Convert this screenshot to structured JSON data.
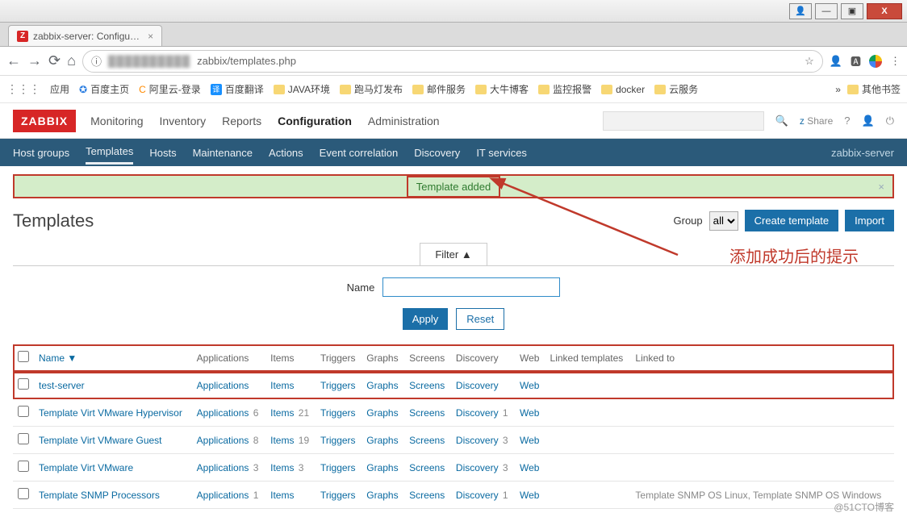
{
  "window": {
    "min": "—",
    "max": "☐",
    "close": "X",
    "box": "▣"
  },
  "browser": {
    "tab_title": "zabbix-server: Configu…",
    "url_hidden": "██████████",
    "url_tail": "zabbix/templates.php",
    "star": "☆",
    "icons": {
      "back": "←",
      "fwd": "→",
      "reload": "⟳",
      "home": "⌂",
      "info": "ⓘ",
      "person": "👤",
      "translate": "⠿"
    }
  },
  "bookmarks": {
    "apps_label": "应用",
    "items": [
      "百度主页",
      "阿里云-登录",
      "百度翻译",
      "JAVA环境",
      "跑马灯发布",
      "邮件服务",
      "大牛博客",
      "监控报警",
      "docker",
      "云服务"
    ],
    "more": "»",
    "other": "其他书签"
  },
  "zabbix": {
    "logo": "ZABBIX",
    "menu": [
      "Monitoring",
      "Inventory",
      "Reports",
      "Configuration",
      "Administration"
    ],
    "menu_active": 3,
    "share": "Share",
    "sub": [
      "Host groups",
      "Templates",
      "Hosts",
      "Maintenance",
      "Actions",
      "Event correlation",
      "Discovery",
      "IT services"
    ],
    "sub_active": 1,
    "server": "zabbix-server"
  },
  "alert": {
    "msg": "Template added",
    "close": "×"
  },
  "annotation": "添加成功后的提示",
  "page": {
    "title": "Templates",
    "group_label": "Group",
    "group_value": "all",
    "create_btn": "Create template",
    "import_btn": "Import"
  },
  "filter": {
    "tab": "Filter ▲",
    "name_label": "Name",
    "name_value": "",
    "apply": "Apply",
    "reset": "Reset"
  },
  "columns": [
    "Name ▼",
    "Applications",
    "Items",
    "Triggers",
    "Graphs",
    "Screens",
    "Discovery",
    "Web",
    "Linked templates",
    "Linked to"
  ],
  "rows": [
    {
      "name": "test-server",
      "apps": "Applications",
      "apps_n": "",
      "items": "Items",
      "items_n": "",
      "trig": "Triggers",
      "graphs": "Graphs",
      "screens": "Screens",
      "disc": "Discovery",
      "disc_n": "",
      "web": "Web",
      "linked_templates": "",
      "linked_to": "",
      "hl": true
    },
    {
      "name": "Template Virt VMware Hypervisor",
      "apps": "Applications",
      "apps_n": "6",
      "items": "Items",
      "items_n": "21",
      "trig": "Triggers",
      "graphs": "Graphs",
      "screens": "Screens",
      "disc": "Discovery",
      "disc_n": "1",
      "web": "Web",
      "linked_templates": "",
      "linked_to": ""
    },
    {
      "name": "Template Virt VMware Guest",
      "apps": "Applications",
      "apps_n": "8",
      "items": "Items",
      "items_n": "19",
      "trig": "Triggers",
      "graphs": "Graphs",
      "screens": "Screens",
      "disc": "Discovery",
      "disc_n": "3",
      "web": "Web",
      "linked_templates": "",
      "linked_to": ""
    },
    {
      "name": "Template Virt VMware",
      "apps": "Applications",
      "apps_n": "3",
      "items": "Items",
      "items_n": "3",
      "trig": "Triggers",
      "graphs": "Graphs",
      "screens": "Screens",
      "disc": "Discovery",
      "disc_n": "3",
      "web": "Web",
      "linked_templates": "",
      "linked_to": ""
    },
    {
      "name": "Template SNMP Processors",
      "apps": "Applications",
      "apps_n": "1",
      "items": "Items",
      "items_n": "",
      "trig": "Triggers",
      "graphs": "Graphs",
      "screens": "Screens",
      "disc": "Discovery",
      "disc_n": "1",
      "web": "Web",
      "linked_templates": "",
      "linked_to": "Template SNMP OS Linux, Template SNMP OS Windows"
    }
  ],
  "watermark": "@51CTO博客"
}
